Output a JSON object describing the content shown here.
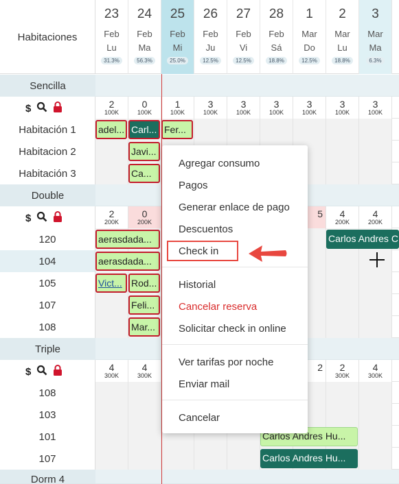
{
  "corner_label": "Habitaciones",
  "days": [
    {
      "num": "23",
      "mon": "Feb",
      "wd": "Lu",
      "pct": "31.3%"
    },
    {
      "num": "24",
      "mon": "Feb",
      "wd": "Ma",
      "pct": "56.3%"
    },
    {
      "num": "25",
      "mon": "Feb",
      "wd": "Mi",
      "pct": "25.0%"
    },
    {
      "num": "26",
      "mon": "Feb",
      "wd": "Ju",
      "pct": "12.5%"
    },
    {
      "num": "27",
      "mon": "Feb",
      "wd": "Vi",
      "pct": "12.5%"
    },
    {
      "num": "28",
      "mon": "Feb",
      "wd": "Sá",
      "pct": "18.8%"
    },
    {
      "num": "1",
      "mon": "Mar",
      "wd": "Do",
      "pct": "12.5%"
    },
    {
      "num": "2",
      "mon": "Mar",
      "wd": "Lu",
      "pct": "18.8%"
    },
    {
      "num": "3",
      "mon": "Mar",
      "wd": "Ma",
      "pct": "6.3%"
    }
  ],
  "sections": {
    "sencilla": {
      "label": "Sencilla",
      "avail": [
        {
          "count": "2",
          "price": "100K"
        },
        {
          "count": "0",
          "price": "100K"
        },
        {
          "count": "1",
          "price": "100K"
        },
        {
          "count": "3",
          "price": "100K"
        },
        {
          "count": "3",
          "price": "100K"
        },
        {
          "count": "3",
          "price": "100K"
        },
        {
          "count": "3",
          "price": "100K"
        },
        {
          "count": "3",
          "price": "100K"
        },
        {
          "count": "3",
          "price": "100K"
        }
      ],
      "rooms": [
        "Habitación 1",
        "Habitacion 2",
        "Habitación 3"
      ]
    },
    "double": {
      "label": "Double",
      "avail": [
        {
          "count": "2",
          "price": "200K"
        },
        {
          "count": "0",
          "price": "200K"
        },
        {
          "count": "5",
          "price": ""
        },
        {
          "count": "4",
          "price": "200K"
        },
        {
          "count": "4",
          "price": "200K"
        }
      ],
      "rooms": [
        "120",
        "104",
        "105",
        "107",
        "108"
      ]
    },
    "triple": {
      "label": "Triple",
      "avail": [
        {
          "count": "4",
          "price": "300K"
        },
        {
          "count": "4",
          "price": "300K"
        },
        {
          "count": "2",
          "price": ""
        },
        {
          "count": "2",
          "price": "300K"
        },
        {
          "count": "4",
          "price": "300K"
        }
      ],
      "rooms": [
        "108",
        "103",
        "101",
        "107"
      ]
    },
    "dorm": {
      "label": "Dorm 4"
    }
  },
  "reservations": {
    "r1": "adel...",
    "r2": "Carl...",
    "r3": "Fer...",
    "r4": "Javi...",
    "r5": "Ca...",
    "r6": "aerasdada...",
    "r7": "Carlos Andres C",
    "r8": "aerasdada...",
    "r9": "Vict...",
    "r10": "Rod...",
    "r11": "Feli...",
    "r12": "Mar...",
    "r13": "Carlos Andres Hu...",
    "r14": "Carlos Andres Hu..."
  },
  "context_menu": {
    "items": [
      "Agregar consumo",
      "Pagos",
      "Generar enlace de pago",
      "Descuentos",
      "Check in",
      "Historial",
      "Cancelar reserva",
      "Solicitar check in online",
      "Ver tarifas por noche",
      "Enviar mail",
      "Cancelar"
    ]
  },
  "toolbar_icons": [
    "dollar-icon",
    "search-icon",
    "lock-icon"
  ],
  "colors": {
    "today_column": "#bde3ec",
    "reservation_light": "#c8f4a8",
    "reservation_dark": "#1b6e5e",
    "reservation_border": "#c31c2c",
    "danger": "#d92c2c",
    "highlight_box": "#e8473f"
  }
}
